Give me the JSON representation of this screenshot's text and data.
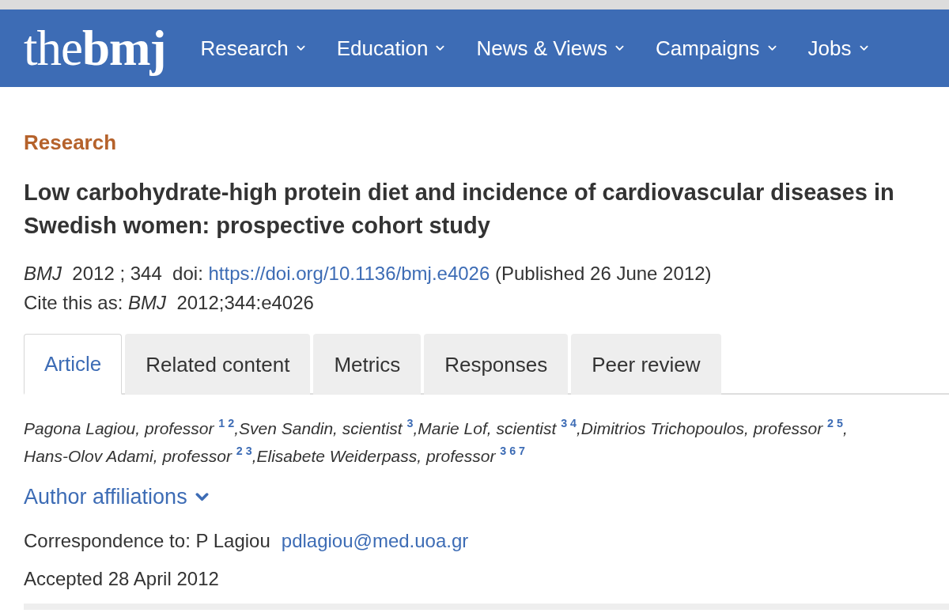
{
  "header": {
    "logo": "the**bmj**",
    "nav": [
      "Research",
      "Education",
      "News & Views",
      "Campaigns",
      "Jobs"
    ]
  },
  "article": {
    "section": "Research",
    "title": "Low carbohydrate-high protein diet and incidence of cardiovascular diseases in Swedish women: prospective cohort study",
    "citation": {
      "prefix": "*BMJ*  2012 ; 344  doi:",
      "doi": "https://doi.org/10.1136/bmj.e4026",
      "published": "(Published 26 June 2012)"
    },
    "cite_as": "Cite this as: *BMJ*  2012;344:e4026"
  },
  "tabs": [
    {
      "label": "Article",
      "selected": true
    },
    {
      "label": "Related content",
      "selected": false
    },
    {
      "label": "Metrics",
      "selected": false
    },
    {
      "label": "Responses",
      "selected": false
    },
    {
      "label": "Peer review",
      "selected": false
    }
  ],
  "authors": [
    "Pagona Lagiou, professor $^{1 2}$,",
    "Sven Sandin, scientist $^{3}$,",
    "Marie Lof, scientist $^{3 4}$,",
    "Dimitrios Trichopoulos, professor $^{2 5}$,",
    "Hans-Olov Adami, professor $^{2 3}$,",
    "Elisabete Weiderpass, professor $^{3 6 7}$"
  ],
  "affiliations_link": "Author affiliations",
  "correspondence": {
    "text": "Correspondence to: P Lagiou",
    "email": "pdlagiou@med.uoa.gr"
  },
  "accepted": "Accepted 28 April 2012"
}
